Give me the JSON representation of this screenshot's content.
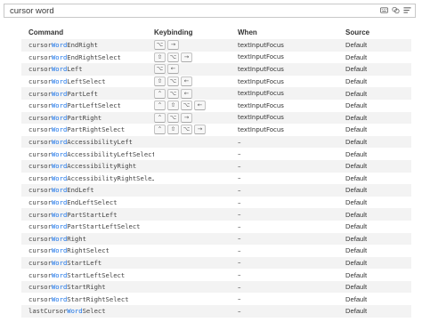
{
  "search": {
    "value": "cursor word",
    "icons": [
      "keyboard-icon",
      "record-keys-icon",
      "sort-precedence-icon"
    ]
  },
  "table": {
    "headers": {
      "command": "Command",
      "keybinding": "Keybinding",
      "when": "When",
      "source": "Source"
    },
    "rows": [
      {
        "pre": "cursor",
        "hl": "Word",
        "post": "EndRight",
        "keys": [
          "⌥",
          "→"
        ],
        "when": "textInputFocus",
        "source": "Default"
      },
      {
        "pre": "cursor",
        "hl": "Word",
        "post": "EndRightSelect",
        "keys": [
          "⇧",
          "⌥",
          "→"
        ],
        "when": "textInputFocus",
        "source": "Default"
      },
      {
        "pre": "cursor",
        "hl": "Word",
        "post": "Left",
        "keys": [
          "⌥",
          "←"
        ],
        "when": "textInputFocus",
        "source": "Default"
      },
      {
        "pre": "cursor",
        "hl": "Word",
        "post": "LeftSelect",
        "keys": [
          "⇧",
          "⌥",
          "←"
        ],
        "when": "textInputFocus",
        "source": "Default"
      },
      {
        "pre": "cursor",
        "hl": "Word",
        "post": "PartLeft",
        "keys": [
          "⌃",
          "⌥",
          "←"
        ],
        "when": "textInputFocus",
        "source": "Default"
      },
      {
        "pre": "cursor",
        "hl": "Word",
        "post": "PartLeftSelect",
        "keys": [
          "⌃",
          "⇧",
          "⌥",
          "←"
        ],
        "when": "textInputFocus",
        "source": "Default"
      },
      {
        "pre": "cursor",
        "hl": "Word",
        "post": "PartRight",
        "keys": [
          "⌃",
          "⌥",
          "→"
        ],
        "when": "textInputFocus",
        "source": "Default"
      },
      {
        "pre": "cursor",
        "hl": "Word",
        "post": "PartRightSelect",
        "keys": [
          "⌃",
          "⇧",
          "⌥",
          "→"
        ],
        "when": "textInputFocus",
        "source": "Default"
      },
      {
        "pre": "cursor",
        "hl": "Word",
        "post": "AccessibilityLeft",
        "keys": [],
        "when": "–",
        "source": "Default"
      },
      {
        "pre": "cursor",
        "hl": "Word",
        "post": "AccessibilityLeftSelect",
        "keys": [],
        "when": "–",
        "source": "Default"
      },
      {
        "pre": "cursor",
        "hl": "Word",
        "post": "AccessibilityRight",
        "keys": [],
        "when": "–",
        "source": "Default"
      },
      {
        "pre": "cursor",
        "hl": "Word",
        "post": "AccessibilityRightSele…",
        "keys": [],
        "when": "–",
        "source": "Default"
      },
      {
        "pre": "cursor",
        "hl": "Word",
        "post": "EndLeft",
        "keys": [],
        "when": "–",
        "source": "Default"
      },
      {
        "pre": "cursor",
        "hl": "Word",
        "post": "EndLeftSelect",
        "keys": [],
        "when": "–",
        "source": "Default"
      },
      {
        "pre": "cursor",
        "hl": "Word",
        "post": "PartStartLeft",
        "keys": [],
        "when": "–",
        "source": "Default"
      },
      {
        "pre": "cursor",
        "hl": "Word",
        "post": "PartStartLeftSelect",
        "keys": [],
        "when": "–",
        "source": "Default"
      },
      {
        "pre": "cursor",
        "hl": "Word",
        "post": "Right",
        "keys": [],
        "when": "–",
        "source": "Default"
      },
      {
        "pre": "cursor",
        "hl": "Word",
        "post": "RightSelect",
        "keys": [],
        "when": "–",
        "source": "Default"
      },
      {
        "pre": "cursor",
        "hl": "Word",
        "post": "StartLeft",
        "keys": [],
        "when": "–",
        "source": "Default"
      },
      {
        "pre": "cursor",
        "hl": "Word",
        "post": "StartLeftSelect",
        "keys": [],
        "when": "–",
        "source": "Default"
      },
      {
        "pre": "cursor",
        "hl": "Word",
        "post": "StartRight",
        "keys": [],
        "when": "–",
        "source": "Default"
      },
      {
        "pre": "cursor",
        "hl": "Word",
        "post": "StartRightSelect",
        "keys": [],
        "when": "–",
        "source": "Default"
      },
      {
        "pre": "lastCursor",
        "hl": "Word",
        "post": "Select",
        "keys": [],
        "when": "–",
        "source": "Default"
      }
    ]
  },
  "colors": {
    "highlight": "#1a73e8",
    "row_alt": "#f3f3f3"
  }
}
